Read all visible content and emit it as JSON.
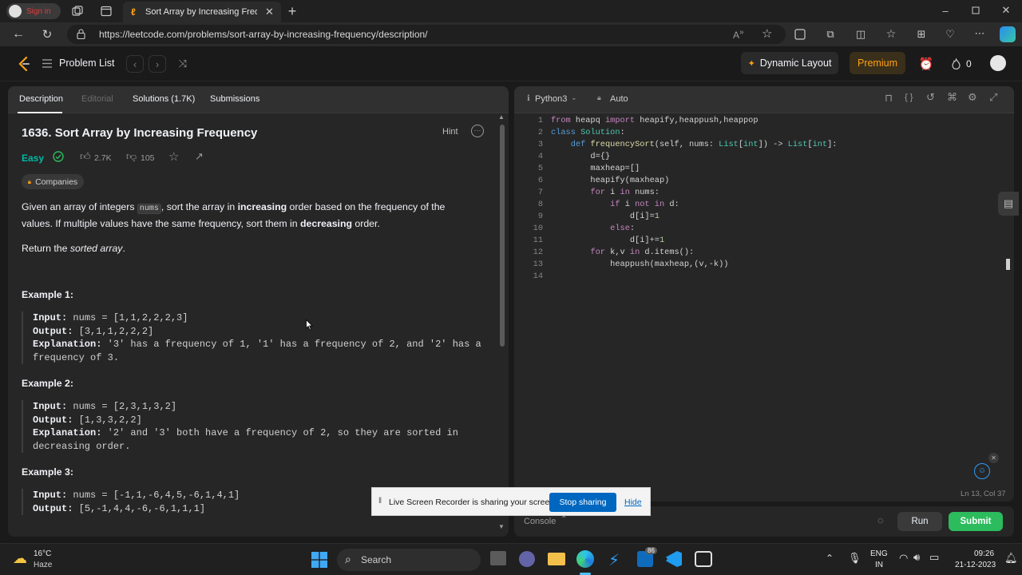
{
  "browser": {
    "profile_label": "Sign in",
    "tab_title": "Sort Array by Increasing Frequen",
    "url": "https://leetcode.com/problems/sort-array-by-increasing-frequency/description/",
    "icons": [
      "tab-actions-icon",
      "workspaces-icon",
      "close-tab-icon",
      "new-tab-icon",
      "back-icon",
      "refresh-icon",
      "lock-icon",
      "read-aloud-icon",
      "favorite-icon",
      "minimize-icon",
      "maximize-icon",
      "close-window-icon"
    ]
  },
  "header": {
    "problem_list": "Problem List",
    "dynamic_layout": "Dynamic Layout",
    "premium": "Premium",
    "streak_count": "0",
    "colors": {
      "premium": "#ffa116",
      "premium_bg": "#3a2f1a"
    }
  },
  "left_panel": {
    "tabs": [
      "Description",
      "Editorial",
      "Solutions (1.7K)",
      "Submissions"
    ],
    "title": "1636. Sort Array by Increasing Frequency",
    "hint": "Hint",
    "difficulty": "Easy",
    "likes": "2.7K",
    "dislikes": "105",
    "companies": "Companies",
    "desc": {
      "p1_a": "Given an array of integers ",
      "p1_code": "nums",
      "p1_b": ", sort the array in ",
      "p1_bold1": "increasing",
      "p1_c": " order based on the frequency of the values. If multiple values have the same frequency, sort them in ",
      "p1_bold2": "decreasing",
      "p1_d": " order.",
      "p2_a": "Return the ",
      "p2_em": "sorted array",
      "p2_b": "."
    },
    "examples": [
      {
        "title": "Example 1:",
        "input_label": "Input:",
        "input": " nums = [1,1,2,2,2,3]",
        "output_label": "Output:",
        "output": " [3,1,1,2,2,2]",
        "explanation_label": "Explanation:",
        "explanation": " '3' has a frequency of 1, '1' has a frequency of 2, and '2' has a frequency of 3."
      },
      {
        "title": "Example 2:",
        "input_label": "Input:",
        "input": " nums = [2,3,1,3,2]",
        "output_label": "Output:",
        "output": " [1,3,3,2,2]",
        "explanation_label": "Explanation:",
        "explanation": " '2' and '3' both have a frequency of 2, so they are sorted in decreasing order."
      },
      {
        "title": "Example 3:",
        "input_label": "Input:",
        "input": " nums = [-1,1,-6,4,5,-6,1,4,1]",
        "output_label": "Output:",
        "output": " [5,-1,4,4,-6,-6,1,1,1]"
      }
    ],
    "colors": {
      "easy": "#00b8a3"
    }
  },
  "editor": {
    "language": "Python3",
    "mode": "Auto",
    "status": "Ln 13, Col 37",
    "console": "Console",
    "run": "Run",
    "submit": "Submit",
    "colors": {
      "submit": "#2cbb5d"
    },
    "lines": [
      {
        "n": "1",
        "segs": [
          {
            "t": "from",
            "c": "kw"
          },
          {
            "t": " heapq ",
            "c": ""
          },
          {
            "t": "import",
            "c": "kw"
          },
          {
            "t": " heapify,heappush,heappop",
            "c": ""
          }
        ]
      },
      {
        "n": "2",
        "segs": [
          {
            "t": "class",
            "c": "kb"
          },
          {
            "t": " ",
            "c": ""
          },
          {
            "t": "Solution",
            "c": "ty"
          },
          {
            "t": ":",
            "c": ""
          }
        ]
      },
      {
        "n": "3",
        "segs": [
          {
            "t": "    ",
            "c": ""
          },
          {
            "t": "def",
            "c": "kb"
          },
          {
            "t": " ",
            "c": ""
          },
          {
            "t": "frequencySort",
            "c": "fn"
          },
          {
            "t": "(self, nums: ",
            "c": ""
          },
          {
            "t": "List",
            "c": "ty"
          },
          {
            "t": "[",
            "c": ""
          },
          {
            "t": "int",
            "c": "ty"
          },
          {
            "t": "]) -> ",
            "c": ""
          },
          {
            "t": "List",
            "c": "ty"
          },
          {
            "t": "[",
            "c": ""
          },
          {
            "t": "int",
            "c": "ty"
          },
          {
            "t": "]:",
            "c": ""
          }
        ]
      },
      {
        "n": "4",
        "segs": [
          {
            "t": "        d={}",
            "c": ""
          }
        ]
      },
      {
        "n": "5",
        "segs": [
          {
            "t": "        maxheap=[]",
            "c": ""
          }
        ]
      },
      {
        "n": "6",
        "segs": [
          {
            "t": "        heapify(maxheap)",
            "c": ""
          }
        ]
      },
      {
        "n": "7",
        "segs": [
          {
            "t": "        ",
            "c": ""
          },
          {
            "t": "for",
            "c": "kw"
          },
          {
            "t": " i ",
            "c": ""
          },
          {
            "t": "in",
            "c": "kw"
          },
          {
            "t": " nums:",
            "c": ""
          }
        ]
      },
      {
        "n": "8",
        "segs": [
          {
            "t": "            ",
            "c": ""
          },
          {
            "t": "if",
            "c": "kw"
          },
          {
            "t": " i ",
            "c": ""
          },
          {
            "t": "not in",
            "c": "kw"
          },
          {
            "t": " d:",
            "c": ""
          }
        ]
      },
      {
        "n": "9",
        "segs": [
          {
            "t": "                d[i]=",
            "c": ""
          },
          {
            "t": "1",
            "c": "nm"
          }
        ]
      },
      {
        "n": "10",
        "segs": [
          {
            "t": "            ",
            "c": ""
          },
          {
            "t": "else",
            "c": "kw"
          },
          {
            "t": ":",
            "c": ""
          }
        ]
      },
      {
        "n": "11",
        "segs": [
          {
            "t": "                d[i]+=",
            "c": ""
          },
          {
            "t": "1",
            "c": "nm"
          }
        ]
      },
      {
        "n": "12",
        "segs": [
          {
            "t": "        ",
            "c": ""
          },
          {
            "t": "for",
            "c": "kw"
          },
          {
            "t": " k,v ",
            "c": ""
          },
          {
            "t": "in",
            "c": "kw"
          },
          {
            "t": " d.items():",
            "c": ""
          }
        ]
      },
      {
        "n": "13",
        "segs": [
          {
            "t": "            heappush(maxheap,(v,-k))",
            "c": ""
          }
        ]
      },
      {
        "n": "14",
        "segs": []
      }
    ]
  },
  "share_bar": {
    "message": "Live Screen Recorder is sharing your screen.",
    "stop": "Stop sharing",
    "hide": "Hide",
    "colors": {
      "stop": "#0067c0"
    }
  },
  "taskbar": {
    "temp": "16°C",
    "weather": "Haze",
    "search": "Search",
    "lang": "ENG",
    "region": "IN",
    "time": "09:26",
    "date": "21-12-2023",
    "badge": "86"
  }
}
